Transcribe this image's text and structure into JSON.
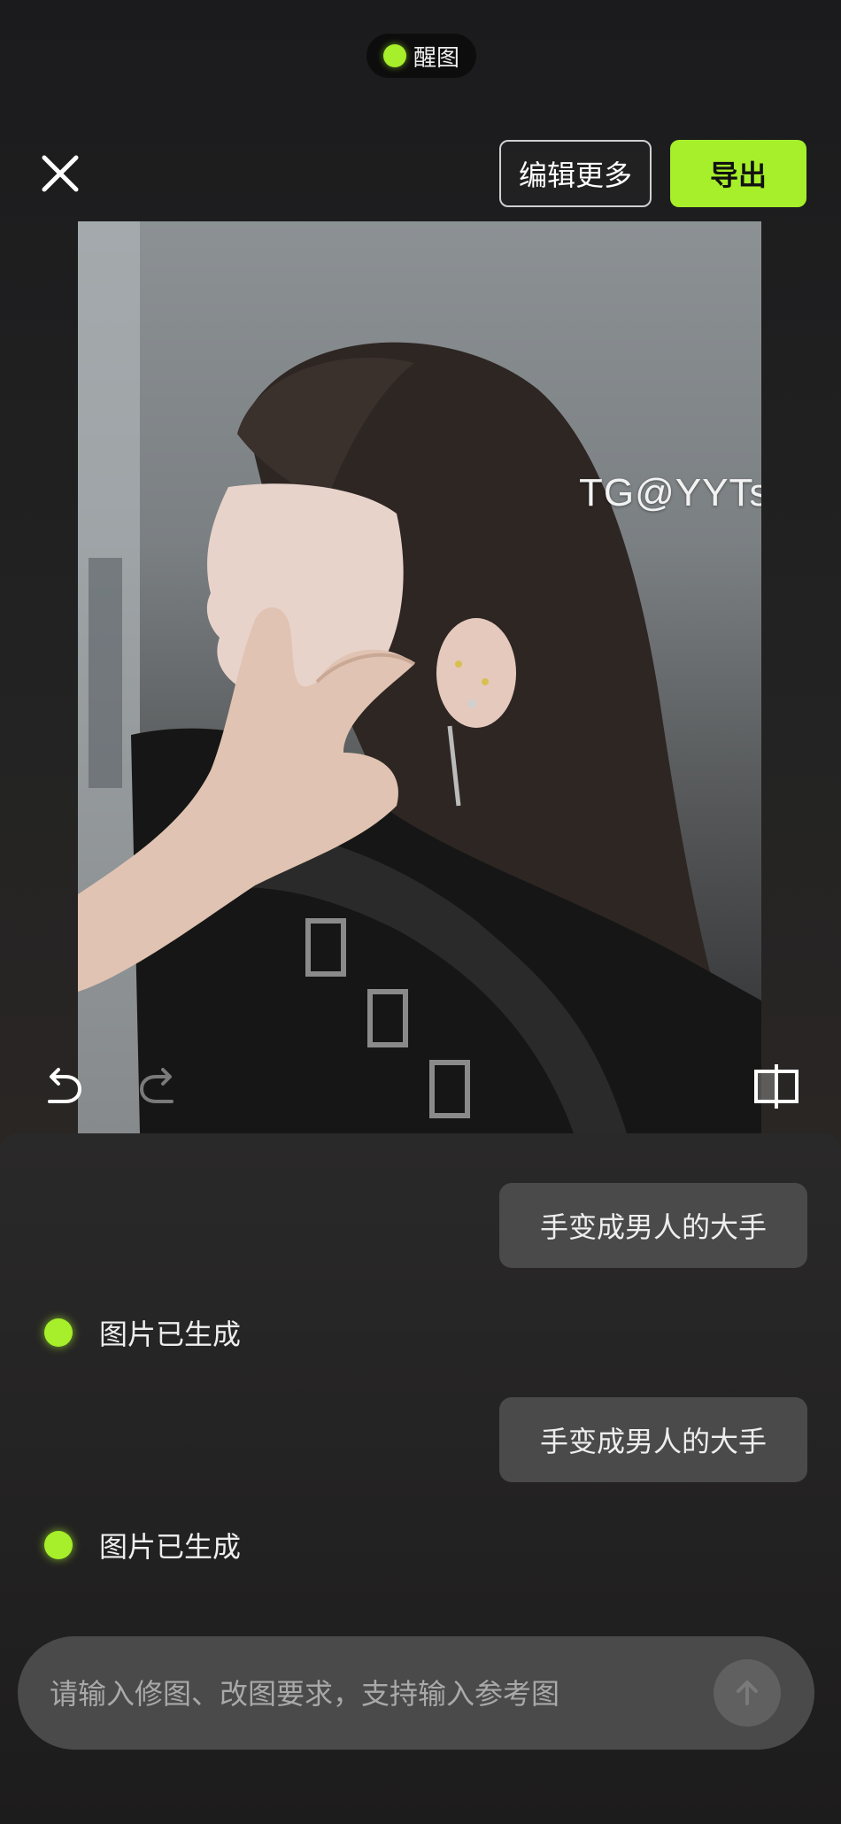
{
  "header": {
    "brand_name": "醒图",
    "brand_dot_color": "#a6ef2a",
    "close_icon": "close-icon",
    "edit_more_label": "编辑更多",
    "export_label": "导出",
    "accent_color": "#a6ef2a"
  },
  "canvas": {
    "watermark": "TG@YYTsir",
    "tools": [
      "undo-icon",
      "redo-icon",
      "compare-icon"
    ]
  },
  "chat": {
    "messages": [
      {
        "role": "user",
        "text": "手变成男人的大手"
      },
      {
        "role": "assistant",
        "text": "图片已生成"
      },
      {
        "role": "user",
        "text": "手变成男人的大手"
      },
      {
        "role": "assistant",
        "text": "图片已生成"
      }
    ]
  },
  "composer": {
    "placeholder": "请输入修图、改图要求，支持输入参考图",
    "send_icon": "arrow-up-icon"
  }
}
